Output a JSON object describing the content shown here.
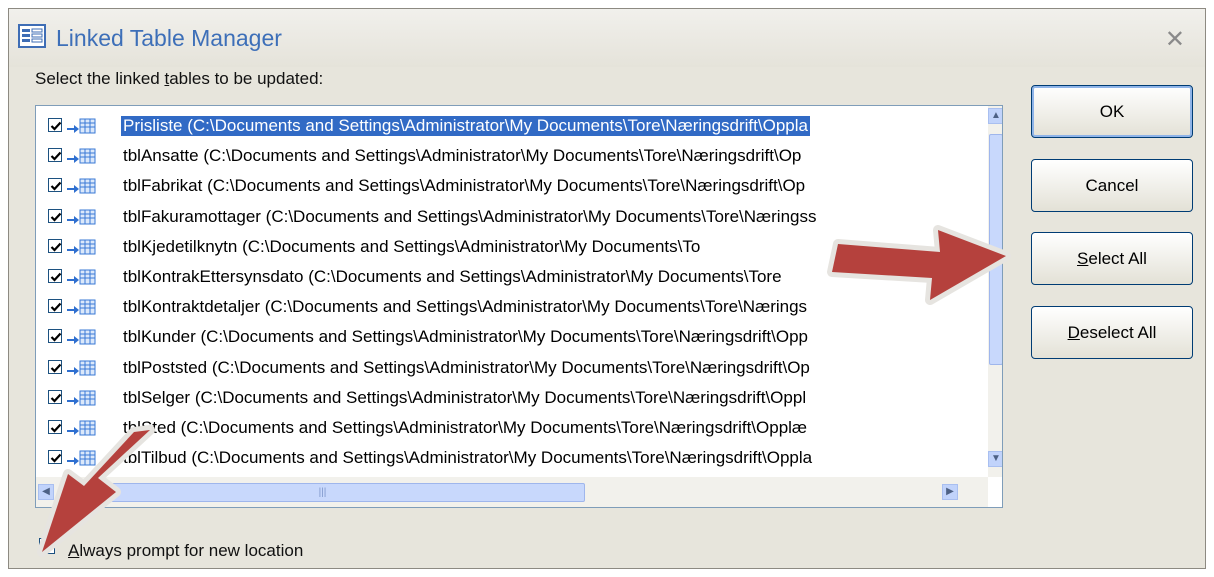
{
  "window": {
    "title": "Linked Table Manager",
    "close_icon": "close-x",
    "instruction_prefix": "Select the linked ",
    "instruction_accel": "t",
    "instruction_suffix": "ables to be updated:"
  },
  "tables": [
    {
      "text": "Prisliste   (C:\\Documents and Settings\\Administrator\\My Documents\\Tore\\Næringsdrift\\Oppla",
      "checked": true,
      "selected": true
    },
    {
      "text": "tblAnsatte   (C:\\Documents and Settings\\Administrator\\My Documents\\Tore\\Næringsdrift\\Op",
      "checked": true,
      "selected": false
    },
    {
      "text": "tblFabrikat   (C:\\Documents and Settings\\Administrator\\My Documents\\Tore\\Næringsdrift\\Op",
      "checked": true,
      "selected": false
    },
    {
      "text": "tblFakuramottager   (C:\\Documents and Settings\\Administrator\\My Documents\\Tore\\Næringss",
      "checked": true,
      "selected": false
    },
    {
      "text": "tblKjedetilknytn   (C:\\Documents and Settings\\Administrator\\My Documents\\To",
      "checked": true,
      "selected": false
    },
    {
      "text": "tblKontrakEttersynsdato   (C:\\Documents and Settings\\Administrator\\My Documents\\Tore",
      "checked": true,
      "selected": false
    },
    {
      "text": "tblKontraktdetaljer   (C:\\Documents and Settings\\Administrator\\My Documents\\Tore\\Nærings",
      "checked": true,
      "selected": false
    },
    {
      "text": "tblKunder   (C:\\Documents and Settings\\Administrator\\My Documents\\Tore\\Næringsdrift\\Opp",
      "checked": true,
      "selected": false
    },
    {
      "text": "tblPoststed   (C:\\Documents and Settings\\Administrator\\My Documents\\Tore\\Næringsdrift\\Op",
      "checked": true,
      "selected": false
    },
    {
      "text": "tblSelger   (C:\\Documents and Settings\\Administrator\\My Documents\\Tore\\Næringsdrift\\Oppl",
      "checked": true,
      "selected": false
    },
    {
      "text": "tblSted   (C:\\Documents and Settings\\Administrator\\My Documents\\Tore\\Næringsdrift\\Opplæ",
      "checked": true,
      "selected": false
    },
    {
      "text": "tblTilbud   (C:\\Documents and Settings\\Administrator\\My Documents\\Tore\\Næringsdrift\\Oppla",
      "checked": true,
      "selected": false
    }
  ],
  "buttons": {
    "ok": "OK",
    "cancel": "Cancel",
    "select_all_accel": "S",
    "select_all_rest": "elect All",
    "deselect_all_accel": "D",
    "deselect_all_rest": "eselect All"
  },
  "always_prompt": {
    "accel": "A",
    "rest": "lways prompt for new location",
    "checked": true
  },
  "colors": {
    "title_text": "#3d6fb8",
    "selection": "#316ac5",
    "annotation_arrow": "#b5413d"
  }
}
